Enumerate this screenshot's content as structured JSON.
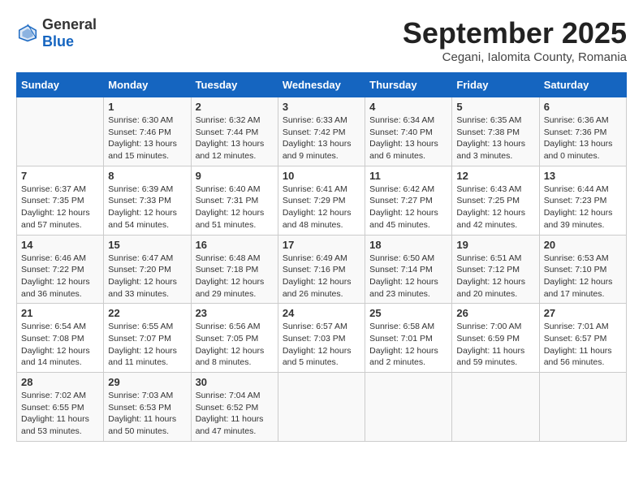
{
  "header": {
    "logo_general": "General",
    "logo_blue": "Blue",
    "month_title": "September 2025",
    "subtitle": "Cegani, Ialomita County, Romania"
  },
  "weekdays": [
    "Sunday",
    "Monday",
    "Tuesday",
    "Wednesday",
    "Thursday",
    "Friday",
    "Saturday"
  ],
  "weeks": [
    [
      {
        "day": "",
        "sunrise": "",
        "sunset": "",
        "daylight": ""
      },
      {
        "day": "1",
        "sunrise": "Sunrise: 6:30 AM",
        "sunset": "Sunset: 7:46 PM",
        "daylight": "Daylight: 13 hours and 15 minutes."
      },
      {
        "day": "2",
        "sunrise": "Sunrise: 6:32 AM",
        "sunset": "Sunset: 7:44 PM",
        "daylight": "Daylight: 13 hours and 12 minutes."
      },
      {
        "day": "3",
        "sunrise": "Sunrise: 6:33 AM",
        "sunset": "Sunset: 7:42 PM",
        "daylight": "Daylight: 13 hours and 9 minutes."
      },
      {
        "day": "4",
        "sunrise": "Sunrise: 6:34 AM",
        "sunset": "Sunset: 7:40 PM",
        "daylight": "Daylight: 13 hours and 6 minutes."
      },
      {
        "day": "5",
        "sunrise": "Sunrise: 6:35 AM",
        "sunset": "Sunset: 7:38 PM",
        "daylight": "Daylight: 13 hours and 3 minutes."
      },
      {
        "day": "6",
        "sunrise": "Sunrise: 6:36 AM",
        "sunset": "Sunset: 7:36 PM",
        "daylight": "Daylight: 13 hours and 0 minutes."
      }
    ],
    [
      {
        "day": "7",
        "sunrise": "Sunrise: 6:37 AM",
        "sunset": "Sunset: 7:35 PM",
        "daylight": "Daylight: 12 hours and 57 minutes."
      },
      {
        "day": "8",
        "sunrise": "Sunrise: 6:39 AM",
        "sunset": "Sunset: 7:33 PM",
        "daylight": "Daylight: 12 hours and 54 minutes."
      },
      {
        "day": "9",
        "sunrise": "Sunrise: 6:40 AM",
        "sunset": "Sunset: 7:31 PM",
        "daylight": "Daylight: 12 hours and 51 minutes."
      },
      {
        "day": "10",
        "sunrise": "Sunrise: 6:41 AM",
        "sunset": "Sunset: 7:29 PM",
        "daylight": "Daylight: 12 hours and 48 minutes."
      },
      {
        "day": "11",
        "sunrise": "Sunrise: 6:42 AM",
        "sunset": "Sunset: 7:27 PM",
        "daylight": "Daylight: 12 hours and 45 minutes."
      },
      {
        "day": "12",
        "sunrise": "Sunrise: 6:43 AM",
        "sunset": "Sunset: 7:25 PM",
        "daylight": "Daylight: 12 hours and 42 minutes."
      },
      {
        "day": "13",
        "sunrise": "Sunrise: 6:44 AM",
        "sunset": "Sunset: 7:23 PM",
        "daylight": "Daylight: 12 hours and 39 minutes."
      }
    ],
    [
      {
        "day": "14",
        "sunrise": "Sunrise: 6:46 AM",
        "sunset": "Sunset: 7:22 PM",
        "daylight": "Daylight: 12 hours and 36 minutes."
      },
      {
        "day": "15",
        "sunrise": "Sunrise: 6:47 AM",
        "sunset": "Sunset: 7:20 PM",
        "daylight": "Daylight: 12 hours and 33 minutes."
      },
      {
        "day": "16",
        "sunrise": "Sunrise: 6:48 AM",
        "sunset": "Sunset: 7:18 PM",
        "daylight": "Daylight: 12 hours and 29 minutes."
      },
      {
        "day": "17",
        "sunrise": "Sunrise: 6:49 AM",
        "sunset": "Sunset: 7:16 PM",
        "daylight": "Daylight: 12 hours and 26 minutes."
      },
      {
        "day": "18",
        "sunrise": "Sunrise: 6:50 AM",
        "sunset": "Sunset: 7:14 PM",
        "daylight": "Daylight: 12 hours and 23 minutes."
      },
      {
        "day": "19",
        "sunrise": "Sunrise: 6:51 AM",
        "sunset": "Sunset: 7:12 PM",
        "daylight": "Daylight: 12 hours and 20 minutes."
      },
      {
        "day": "20",
        "sunrise": "Sunrise: 6:53 AM",
        "sunset": "Sunset: 7:10 PM",
        "daylight": "Daylight: 12 hours and 17 minutes."
      }
    ],
    [
      {
        "day": "21",
        "sunrise": "Sunrise: 6:54 AM",
        "sunset": "Sunset: 7:08 PM",
        "daylight": "Daylight: 12 hours and 14 minutes."
      },
      {
        "day": "22",
        "sunrise": "Sunrise: 6:55 AM",
        "sunset": "Sunset: 7:07 PM",
        "daylight": "Daylight: 12 hours and 11 minutes."
      },
      {
        "day": "23",
        "sunrise": "Sunrise: 6:56 AM",
        "sunset": "Sunset: 7:05 PM",
        "daylight": "Daylight: 12 hours and 8 minutes."
      },
      {
        "day": "24",
        "sunrise": "Sunrise: 6:57 AM",
        "sunset": "Sunset: 7:03 PM",
        "daylight": "Daylight: 12 hours and 5 minutes."
      },
      {
        "day": "25",
        "sunrise": "Sunrise: 6:58 AM",
        "sunset": "Sunset: 7:01 PM",
        "daylight": "Daylight: 12 hours and 2 minutes."
      },
      {
        "day": "26",
        "sunrise": "Sunrise: 7:00 AM",
        "sunset": "Sunset: 6:59 PM",
        "daylight": "Daylight: 11 hours and 59 minutes."
      },
      {
        "day": "27",
        "sunrise": "Sunrise: 7:01 AM",
        "sunset": "Sunset: 6:57 PM",
        "daylight": "Daylight: 11 hours and 56 minutes."
      }
    ],
    [
      {
        "day": "28",
        "sunrise": "Sunrise: 7:02 AM",
        "sunset": "Sunset: 6:55 PM",
        "daylight": "Daylight: 11 hours and 53 minutes."
      },
      {
        "day": "29",
        "sunrise": "Sunrise: 7:03 AM",
        "sunset": "Sunset: 6:53 PM",
        "daylight": "Daylight: 11 hours and 50 minutes."
      },
      {
        "day": "30",
        "sunrise": "Sunrise: 7:04 AM",
        "sunset": "Sunset: 6:52 PM",
        "daylight": "Daylight: 11 hours and 47 minutes."
      },
      {
        "day": "",
        "sunrise": "",
        "sunset": "",
        "daylight": ""
      },
      {
        "day": "",
        "sunrise": "",
        "sunset": "",
        "daylight": ""
      },
      {
        "day": "",
        "sunrise": "",
        "sunset": "",
        "daylight": ""
      },
      {
        "day": "",
        "sunrise": "",
        "sunset": "",
        "daylight": ""
      }
    ]
  ]
}
